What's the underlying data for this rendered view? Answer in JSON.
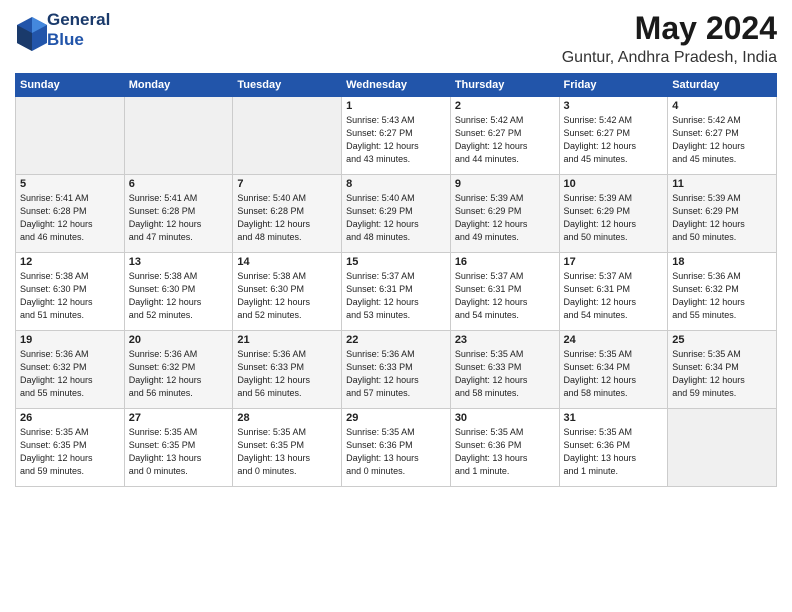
{
  "header": {
    "logo_line1": "General",
    "logo_line2": "Blue",
    "month_year": "May 2024",
    "location": "Guntur, Andhra Pradesh, India"
  },
  "days_of_week": [
    "Sunday",
    "Monday",
    "Tuesday",
    "Wednesday",
    "Thursday",
    "Friday",
    "Saturday"
  ],
  "weeks": [
    [
      {
        "day": "",
        "info": ""
      },
      {
        "day": "",
        "info": ""
      },
      {
        "day": "",
        "info": ""
      },
      {
        "day": "1",
        "info": "Sunrise: 5:43 AM\nSunset: 6:27 PM\nDaylight: 12 hours\nand 43 minutes."
      },
      {
        "day": "2",
        "info": "Sunrise: 5:42 AM\nSunset: 6:27 PM\nDaylight: 12 hours\nand 44 minutes."
      },
      {
        "day": "3",
        "info": "Sunrise: 5:42 AM\nSunset: 6:27 PM\nDaylight: 12 hours\nand 45 minutes."
      },
      {
        "day": "4",
        "info": "Sunrise: 5:42 AM\nSunset: 6:27 PM\nDaylight: 12 hours\nand 45 minutes."
      }
    ],
    [
      {
        "day": "5",
        "info": "Sunrise: 5:41 AM\nSunset: 6:28 PM\nDaylight: 12 hours\nand 46 minutes."
      },
      {
        "day": "6",
        "info": "Sunrise: 5:41 AM\nSunset: 6:28 PM\nDaylight: 12 hours\nand 47 minutes."
      },
      {
        "day": "7",
        "info": "Sunrise: 5:40 AM\nSunset: 6:28 PM\nDaylight: 12 hours\nand 48 minutes."
      },
      {
        "day": "8",
        "info": "Sunrise: 5:40 AM\nSunset: 6:29 PM\nDaylight: 12 hours\nand 48 minutes."
      },
      {
        "day": "9",
        "info": "Sunrise: 5:39 AM\nSunset: 6:29 PM\nDaylight: 12 hours\nand 49 minutes."
      },
      {
        "day": "10",
        "info": "Sunrise: 5:39 AM\nSunset: 6:29 PM\nDaylight: 12 hours\nand 50 minutes."
      },
      {
        "day": "11",
        "info": "Sunrise: 5:39 AM\nSunset: 6:29 PM\nDaylight: 12 hours\nand 50 minutes."
      }
    ],
    [
      {
        "day": "12",
        "info": "Sunrise: 5:38 AM\nSunset: 6:30 PM\nDaylight: 12 hours\nand 51 minutes."
      },
      {
        "day": "13",
        "info": "Sunrise: 5:38 AM\nSunset: 6:30 PM\nDaylight: 12 hours\nand 52 minutes."
      },
      {
        "day": "14",
        "info": "Sunrise: 5:38 AM\nSunset: 6:30 PM\nDaylight: 12 hours\nand 52 minutes."
      },
      {
        "day": "15",
        "info": "Sunrise: 5:37 AM\nSunset: 6:31 PM\nDaylight: 12 hours\nand 53 minutes."
      },
      {
        "day": "16",
        "info": "Sunrise: 5:37 AM\nSunset: 6:31 PM\nDaylight: 12 hours\nand 54 minutes."
      },
      {
        "day": "17",
        "info": "Sunrise: 5:37 AM\nSunset: 6:31 PM\nDaylight: 12 hours\nand 54 minutes."
      },
      {
        "day": "18",
        "info": "Sunrise: 5:36 AM\nSunset: 6:32 PM\nDaylight: 12 hours\nand 55 minutes."
      }
    ],
    [
      {
        "day": "19",
        "info": "Sunrise: 5:36 AM\nSunset: 6:32 PM\nDaylight: 12 hours\nand 55 minutes."
      },
      {
        "day": "20",
        "info": "Sunrise: 5:36 AM\nSunset: 6:32 PM\nDaylight: 12 hours\nand 56 minutes."
      },
      {
        "day": "21",
        "info": "Sunrise: 5:36 AM\nSunset: 6:33 PM\nDaylight: 12 hours\nand 56 minutes."
      },
      {
        "day": "22",
        "info": "Sunrise: 5:36 AM\nSunset: 6:33 PM\nDaylight: 12 hours\nand 57 minutes."
      },
      {
        "day": "23",
        "info": "Sunrise: 5:35 AM\nSunset: 6:33 PM\nDaylight: 12 hours\nand 58 minutes."
      },
      {
        "day": "24",
        "info": "Sunrise: 5:35 AM\nSunset: 6:34 PM\nDaylight: 12 hours\nand 58 minutes."
      },
      {
        "day": "25",
        "info": "Sunrise: 5:35 AM\nSunset: 6:34 PM\nDaylight: 12 hours\nand 59 minutes."
      }
    ],
    [
      {
        "day": "26",
        "info": "Sunrise: 5:35 AM\nSunset: 6:35 PM\nDaylight: 12 hours\nand 59 minutes."
      },
      {
        "day": "27",
        "info": "Sunrise: 5:35 AM\nSunset: 6:35 PM\nDaylight: 13 hours\nand 0 minutes."
      },
      {
        "day": "28",
        "info": "Sunrise: 5:35 AM\nSunset: 6:35 PM\nDaylight: 13 hours\nand 0 minutes."
      },
      {
        "day": "29",
        "info": "Sunrise: 5:35 AM\nSunset: 6:36 PM\nDaylight: 13 hours\nand 0 minutes."
      },
      {
        "day": "30",
        "info": "Sunrise: 5:35 AM\nSunset: 6:36 PM\nDaylight: 13 hours\nand 1 minute."
      },
      {
        "day": "31",
        "info": "Sunrise: 5:35 AM\nSunset: 6:36 PM\nDaylight: 13 hours\nand 1 minute."
      },
      {
        "day": "",
        "info": ""
      }
    ]
  ]
}
